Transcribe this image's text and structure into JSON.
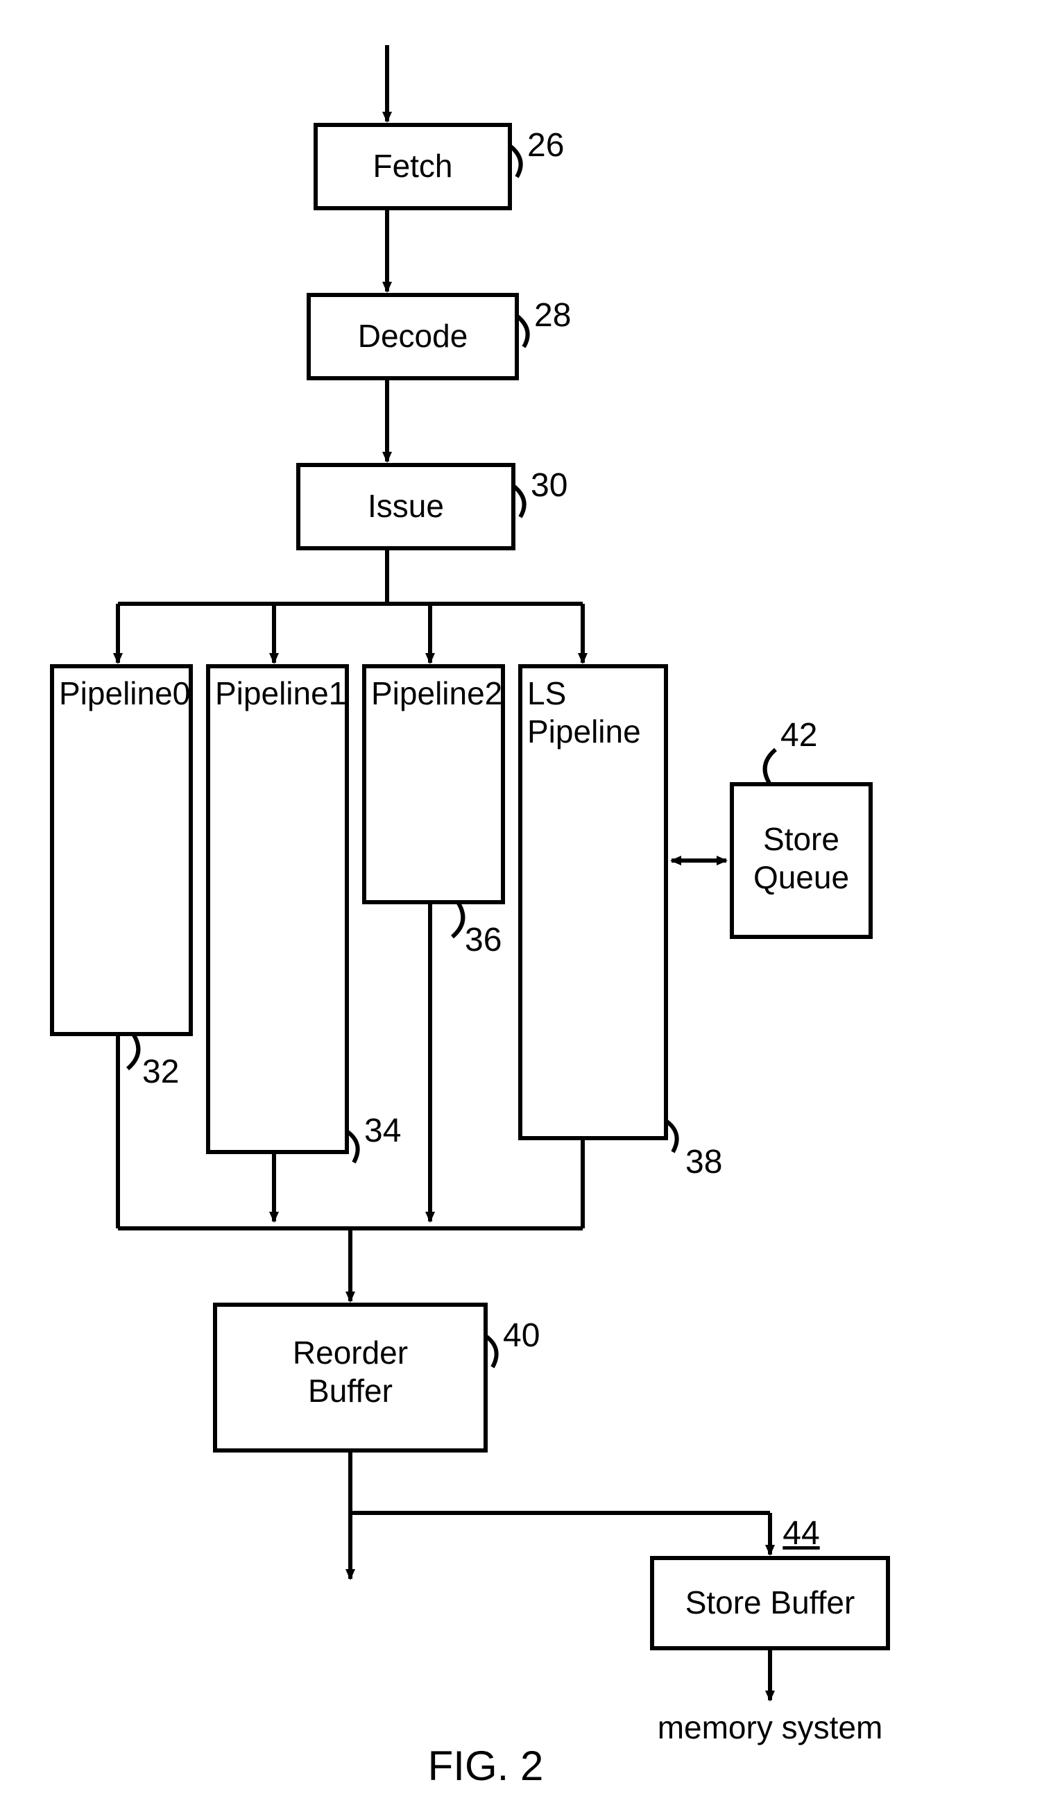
{
  "figure_label": "FIG. 2",
  "blocks": {
    "fetch": {
      "label": "Fetch",
      "ref": "26"
    },
    "decode": {
      "label": "Decode",
      "ref": "28"
    },
    "issue": {
      "label": "Issue",
      "ref": "30"
    },
    "p0": {
      "label": "Pipeline0",
      "ref": "32"
    },
    "p1": {
      "label": "Pipeline1",
      "ref": "34"
    },
    "p2": {
      "label": "Pipeline2",
      "ref": "36"
    },
    "ls": {
      "label1": "LS",
      "label2": "Pipeline",
      "ref": "38"
    },
    "rob": {
      "label1": "Reorder",
      "label2": "Buffer",
      "ref": "40"
    },
    "sq": {
      "label1": "Store",
      "label2": "Queue",
      "ref": "42"
    },
    "sb": {
      "label": "Store Buffer",
      "ref": "44"
    }
  },
  "memory_label": "memory system"
}
